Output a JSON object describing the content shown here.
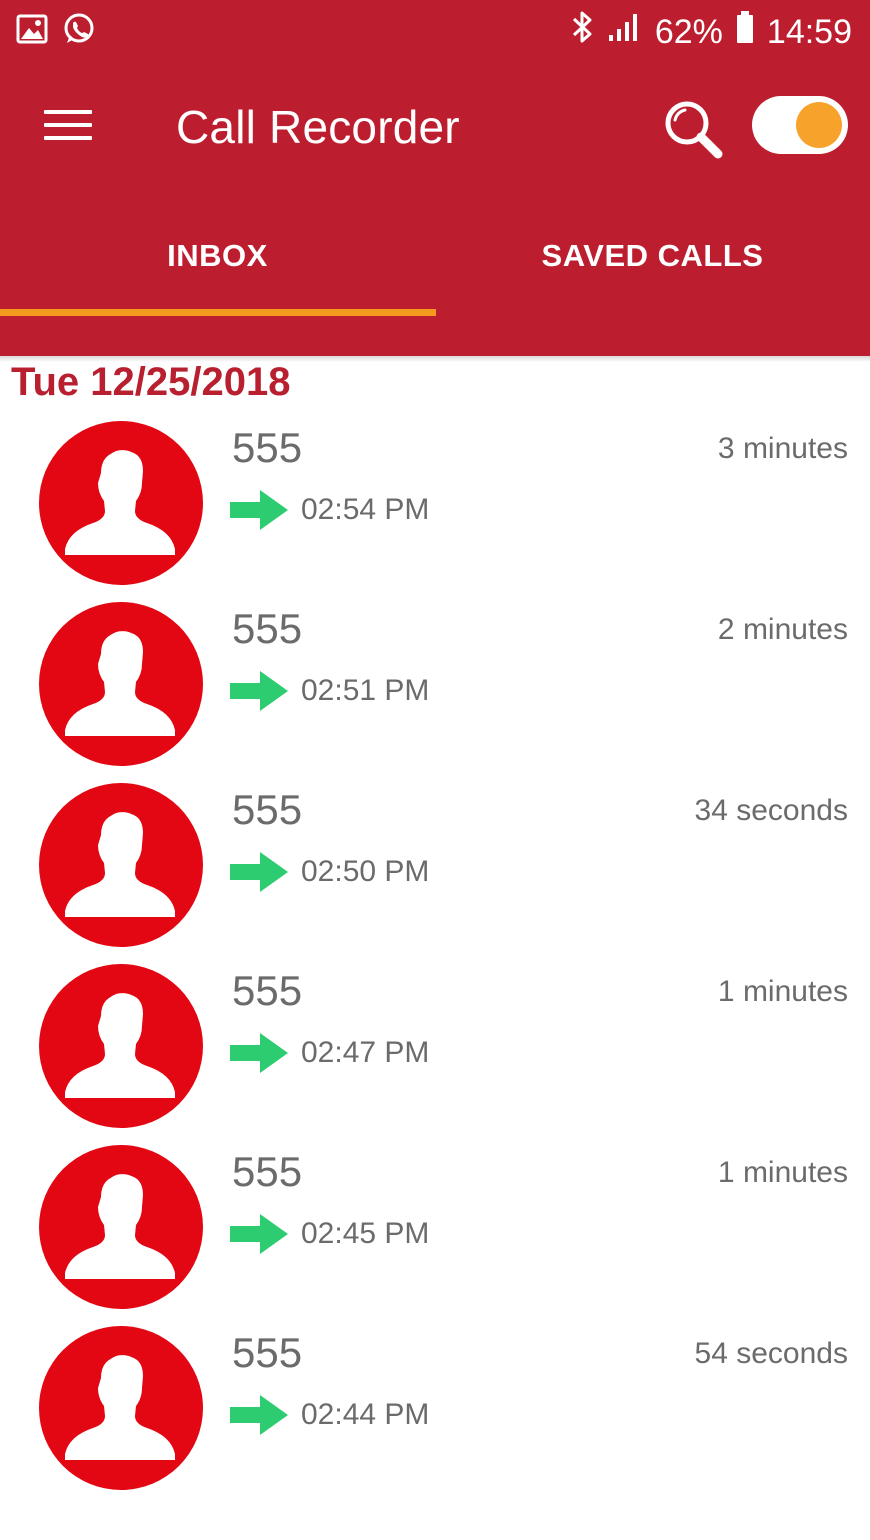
{
  "status_bar": {
    "signal_percent": "62%",
    "time": "14:59",
    "left_icons": [
      "gallery-icon",
      "whatsapp-icon"
    ],
    "right_icons": [
      "bluetooth-icon",
      "signal-icon",
      "battery-icon"
    ]
  },
  "toolbar": {
    "title": "Call Recorder",
    "menu_icon": "hamburger-menu-icon",
    "search_icon": "search-icon",
    "toggle_on": true
  },
  "tabs": [
    {
      "label": "INBOX",
      "active": true
    },
    {
      "label": "SAVED CALLS",
      "active": false
    }
  ],
  "date_header": "Tue 12/25/2018",
  "calls": [
    {
      "number": "555",
      "time": "02:54 PM",
      "duration": "3 minutes",
      "direction": "outgoing"
    },
    {
      "number": "555",
      "time": "02:51 PM",
      "duration": "2 minutes",
      "direction": "outgoing"
    },
    {
      "number": "555",
      "time": "02:50 PM",
      "duration": "34 seconds",
      "direction": "outgoing"
    },
    {
      "number": "555",
      "time": "02:47 PM",
      "duration": "1 minutes",
      "direction": "outgoing"
    },
    {
      "number": "555",
      "time": "02:45 PM",
      "duration": "1 minutes",
      "direction": "outgoing"
    },
    {
      "number": "555",
      "time": "02:44 PM",
      "duration": "54 seconds",
      "direction": "outgoing"
    }
  ],
  "colors": {
    "primary": "#BD1E2F",
    "accent": "#F49A1E",
    "avatar": "#E30613",
    "arrow": "#2ECC71",
    "text_secondary": "#6b6b6b",
    "date_header": "#B8202F"
  }
}
